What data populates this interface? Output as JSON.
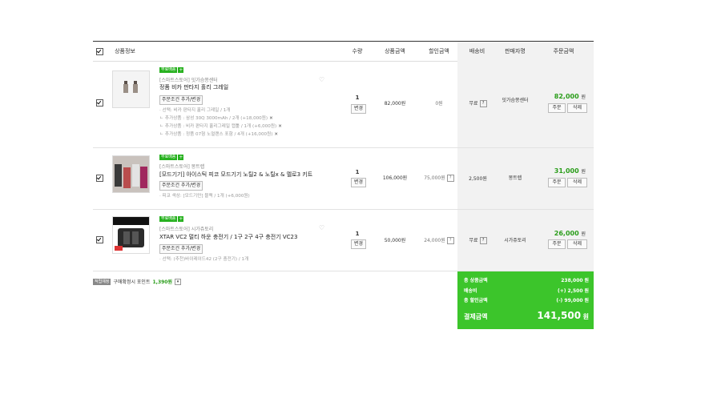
{
  "header": {
    "product_info": "상품정보",
    "qty": "수량",
    "product_amount": "상품금액",
    "discount_amount": "할인금액",
    "shipping": "배송비",
    "seller": "판매자명",
    "order_amount": "주문금액"
  },
  "items": [
    {
      "badge": "무료배송",
      "seller_line": "[스마트스토어] 잇가슴쫑센터",
      "name": "정품 비카 판타지 홀리 그레일",
      "option_btn": "주문조건 추가/변경",
      "options": [
        "· 선택: 비카 판타지 홀리 그레일 / 1개",
        "ㄴ 추가상품 : 삼성 30Q 3000mAh / 2개 (+18,000원)",
        "ㄴ 추가상품 : 비카 판타지 홀리그레일 캡툴 / 1개 (+6,000원)",
        "ㄴ 추가상품 : 정품 07형 노멀랜스 포함 / 4개 (+16,000원)"
      ],
      "qty": "1",
      "change": "변경",
      "amount": "82,000원",
      "discount": "0원",
      "shipping": "무료",
      "seller": "잇가슴쫑센터",
      "total": "82,000",
      "won": "원",
      "order": "주문",
      "delete": "삭제"
    },
    {
      "badge": "무료배송",
      "seller_line": "[스마트스토어] 몽트렙",
      "name": "[모드기기] 아이스틱 피코 모드기기 노틸2 & 노틸x & 멜로3 키트",
      "option_btn": "주문조건 추가/변경",
      "options": [
        "· 피코 색상: [모드기만] 블랙 / 1개 (+6,000원)"
      ],
      "qty": "1",
      "change": "변경",
      "amount": "106,000원",
      "discount": "75,000원",
      "shipping": "2,500원",
      "seller": "몽트렙",
      "total": "31,000",
      "won": "원",
      "order": "주문",
      "delete": "삭제"
    },
    {
      "badge": "무료배송",
      "seller_line": "[스마트스토어] 시가쥬토리",
      "name": "XTAR VC2 멀티 하운 충전기 / 1구 2구 4구 충전기 VC23",
      "option_btn": "주문조건 추가/변경",
      "options": [
        "· 선택: (추천)바이레이드42 (2구 충전기) / 1개"
      ],
      "qty": "1",
      "change": "변경",
      "amount": "50,000원",
      "discount": "24,000원",
      "shipping": "무료",
      "seller": "시가쥬토리",
      "total": "26,000",
      "won": "원",
      "order": "주문",
      "delete": "삭제"
    }
  ],
  "point": {
    "tag": "적립예정",
    "label": "구매확정시 포인트",
    "value": "1,390원"
  },
  "summary": {
    "product_total_label": "총 상품금액",
    "product_total": "238,000",
    "shipping_label": "배송비",
    "shipping": "(+) 2,500",
    "discount_label": "총 할인금액",
    "discount": "(-) 99,000",
    "won": "원",
    "pay_label": "결제금액",
    "pay": "141,500"
  },
  "icons": {
    "heart": "heart-icon",
    "help": "question-icon",
    "remove": "close-icon"
  },
  "colors": {
    "accent": "#3cc52b",
    "price": "#2a9d1a"
  }
}
